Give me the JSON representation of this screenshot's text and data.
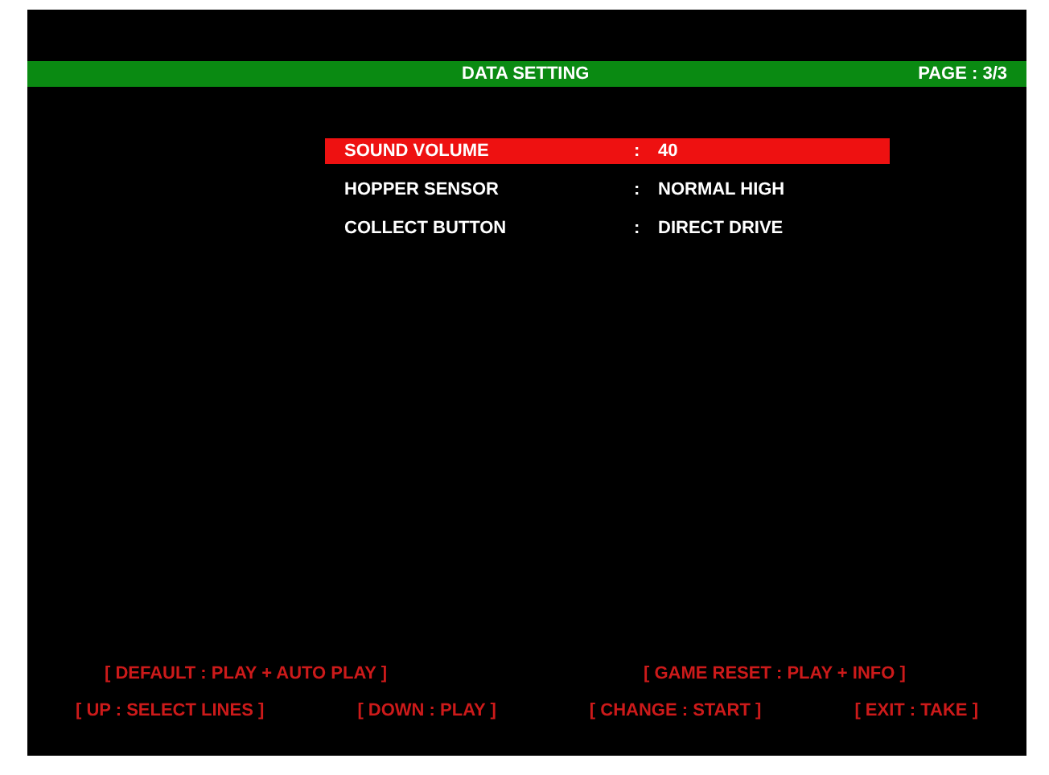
{
  "header": {
    "title": "DATA SETTING",
    "page": "PAGE : 3/3"
  },
  "settings": [
    {
      "label": "SOUND VOLUME",
      "separator": ":",
      "value": "40",
      "selected": true
    },
    {
      "label": "HOPPER SENSOR",
      "separator": ":",
      "value": "NORMAL HIGH",
      "selected": false
    },
    {
      "label": "COLLECT BUTTON",
      "separator": ":",
      "value": "DIRECT DRIVE",
      "selected": false
    }
  ],
  "hints": [
    [
      "[ DEFAULT : PLAY + AUTO PLAY ]",
      "[ GAME RESET : PLAY + INFO ]"
    ],
    [
      "[ UP : SELECT LINES ]",
      "[ DOWN : PLAY ]",
      "[ CHANGE : START ]",
      "[ EXIT : TAKE ]"
    ]
  ]
}
